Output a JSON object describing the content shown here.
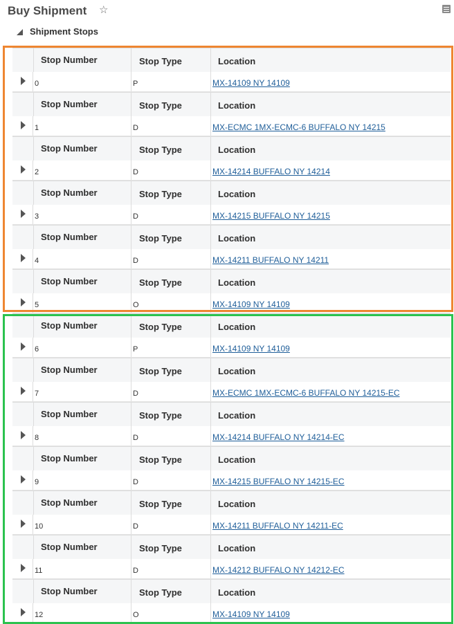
{
  "page": {
    "title": "Buy Shipment"
  },
  "section": {
    "title": "Shipment Stops"
  },
  "columns": {
    "stop_number": "Stop Number",
    "stop_type": "Stop Type",
    "location": "Location"
  },
  "stops": [
    {
      "number": "0",
      "type": "P",
      "location": "MX-14109 NY 14109"
    },
    {
      "number": "1",
      "type": "D",
      "location": "MX-ECMC 1MX-ECMC-6 BUFFALO NY 14215"
    },
    {
      "number": "2",
      "type": "D",
      "location": "MX-14214 BUFFALO NY 14214"
    },
    {
      "number": "3",
      "type": "D",
      "location": "MX-14215 BUFFALO NY 14215"
    },
    {
      "number": "4",
      "type": "D",
      "location": "MX-14211 BUFFALO NY 14211"
    },
    {
      "number": "5",
      "type": "O",
      "location": "MX-14109 NY 14109"
    },
    {
      "number": "6",
      "type": "P",
      "location": "MX-14109 NY 14109"
    },
    {
      "number": "7",
      "type": "D",
      "location": "MX-ECMC 1MX-ECMC-6 BUFFALO NY 14215-EC"
    },
    {
      "number": "8",
      "type": "D",
      "location": "MX-14214 BUFFALO NY 14214-EC"
    },
    {
      "number": "9",
      "type": "D",
      "location": "MX-14215 BUFFALO NY 14215-EC"
    },
    {
      "number": "10",
      "type": "D",
      "location": "MX-14211 BUFFALO NY 14211-EC"
    },
    {
      "number": "11",
      "type": "D",
      "location": "MX-14212 BUFFALO NY 14212-EC"
    },
    {
      "number": "12",
      "type": "O",
      "location": "MX-14109 NY 14109"
    }
  ],
  "icons": {
    "favorite": "star-outline-icon",
    "menu": "page-menu-icon",
    "collapse": "collapse-triangle-icon",
    "expand": "expand-triangle-icon"
  },
  "highlights": {
    "group1_color": "#ee8631",
    "group2_color": "#2bc24e"
  }
}
